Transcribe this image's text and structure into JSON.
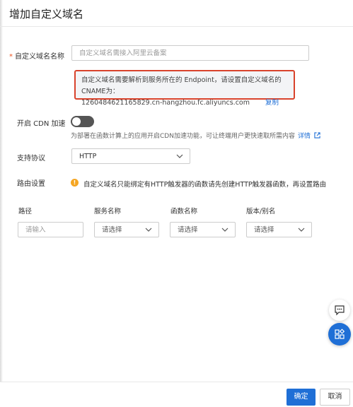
{
  "dialog": {
    "title": "增加自定义域名"
  },
  "domain_field": {
    "label": "自定义域名名称",
    "placeholder": "自定义域名需接入阿里云备案"
  },
  "notice": {
    "line1": "自定义域名需要解析到服务所在的 Endpoint，请设置自定义域名的CNAME为：",
    "endpoint": "1260484621165829.cn-hangzhou.fc.aliyuncs.com",
    "copy_label": "复制"
  },
  "cdn": {
    "label": "开启 CDN 加速",
    "enabled": false,
    "hint": "为部署在函数计算上的应用开启CDN加速功能，可让终端用户更快速取所需内容",
    "details_label": "详情"
  },
  "protocol": {
    "label": "支持协议",
    "value": "HTTP"
  },
  "routing": {
    "label": "路由设置",
    "warning": "自定义域名只能绑定有HTTP触发器的函数请先创建HTTP触发器函数，再设置路由",
    "columns": [
      "路径",
      "服务名称",
      "函数名称",
      "版本/别名"
    ],
    "path_placeholder": "请输入",
    "service_placeholder": "请选择",
    "function_placeholder": "请选择",
    "version_placeholder": "请选择"
  },
  "footer": {
    "confirm_label": "确定",
    "cancel_label": "取消"
  },
  "colors": {
    "primary": "#1f6fd6",
    "highlight_border": "#d9432c",
    "warning": "#f5a623"
  },
  "icons": {
    "chat": "chat-icon",
    "apps": "apps-icon",
    "warning": "warning-icon",
    "external": "external-link-icon"
  }
}
